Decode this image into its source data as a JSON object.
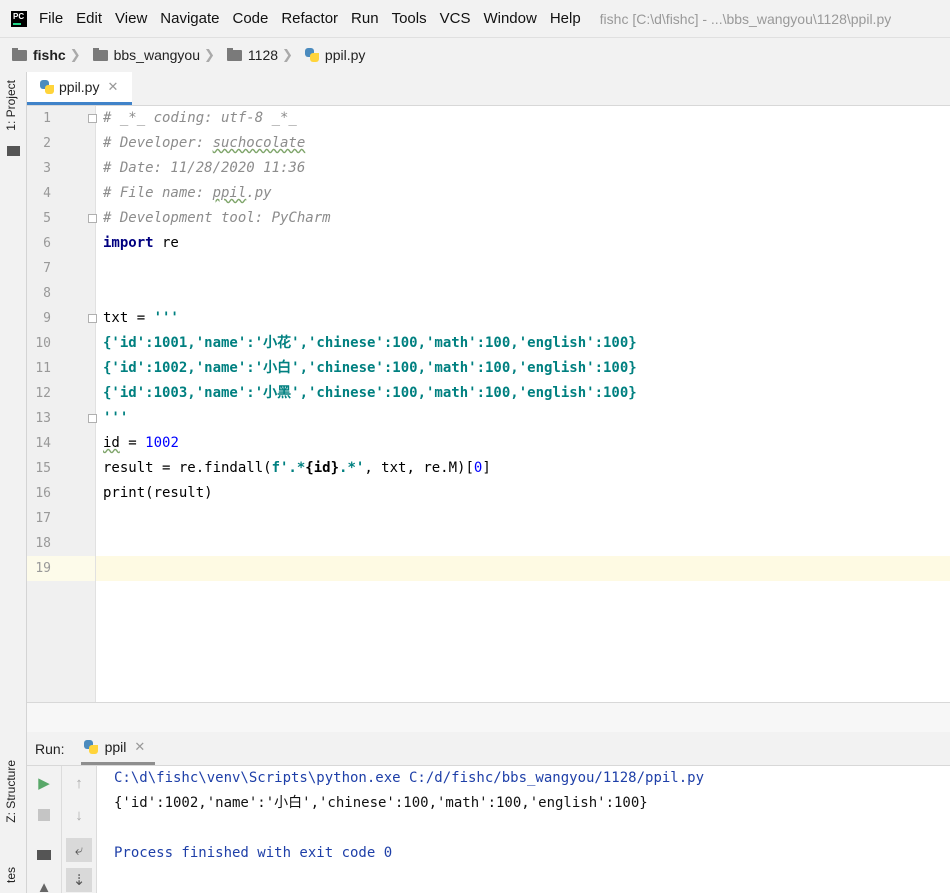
{
  "app": {
    "logo_text": "PC",
    "menu": [
      "File",
      "Edit",
      "View",
      "Navigate",
      "Code",
      "Refactor",
      "Run",
      "Tools",
      "VCS",
      "Window",
      "Help"
    ],
    "window_title": "fishc [C:\\d\\fishc] - ...\\bbs_wangyou\\1128\\ppil.py"
  },
  "breadcrumb": [
    "fishc",
    "bbs_wangyou",
    "1128",
    "ppil.py"
  ],
  "left_strip": {
    "project_tab": "1: Project",
    "structure_tab": "Z: Structure",
    "favorites_tab": "tes"
  },
  "editor": {
    "tab_label": "ppil.py",
    "line_numbers": [
      "1",
      "2",
      "3",
      "4",
      "5",
      "6",
      "7",
      "8",
      "9",
      "10",
      "11",
      "12",
      "13",
      "14",
      "15",
      "16",
      "17",
      "18",
      "19"
    ],
    "current_line": 19,
    "lines": {
      "l1": "# _*_ coding: utf-8 _*_",
      "l2a": "# Developer: ",
      "l2b": "suchocolate",
      "l3": "# Date: 11/28/2020 11:36",
      "l4a": "# File name: ",
      "l4b": "ppil",
      "l4c": ".py",
      "l5": "# Development tool: PyCharm",
      "l6a": "import",
      "l6b": " re",
      "l9a": "txt = ",
      "l9b": "'''",
      "l10": "{'id':1001,'name':'小花','chinese':100,'math':100,'english':100}",
      "l11": "{'id':1002,'name':'小白','chinese':100,'math':100,'english':100}",
      "l12": "{'id':1003,'name':'小黑','chinese':100,'math':100,'english':100}",
      "l13": "'''",
      "l14a": "id",
      "l14b": " = ",
      "l14c": "1002",
      "l15a": "result = re.findall(",
      "l15b": "f'.*",
      "l15c": "{id}",
      "l15d": ".*'",
      "l15e": ", txt, re.M)[",
      "l15f": "0",
      "l15g": "]",
      "l16": "print(result)"
    }
  },
  "run": {
    "label": "Run:",
    "tab_label": "ppil",
    "console": [
      "C:\\d\\fishc\\venv\\Scripts\\python.exe C:/d/fishc/bbs_wangyou/1128/ppil.py",
      "{'id':1002,'name':'小白','chinese':100,'math':100,'english':100}",
      "",
      "Process finished with exit code 0"
    ]
  },
  "colors": {
    "accent_tab": "#4083c9",
    "comment": "#8c8c8c",
    "keyword": "#000080",
    "string": "#008080",
    "number": "#0000ff",
    "console_blue": "#1e3fa8",
    "current_line": "#fefae3"
  }
}
